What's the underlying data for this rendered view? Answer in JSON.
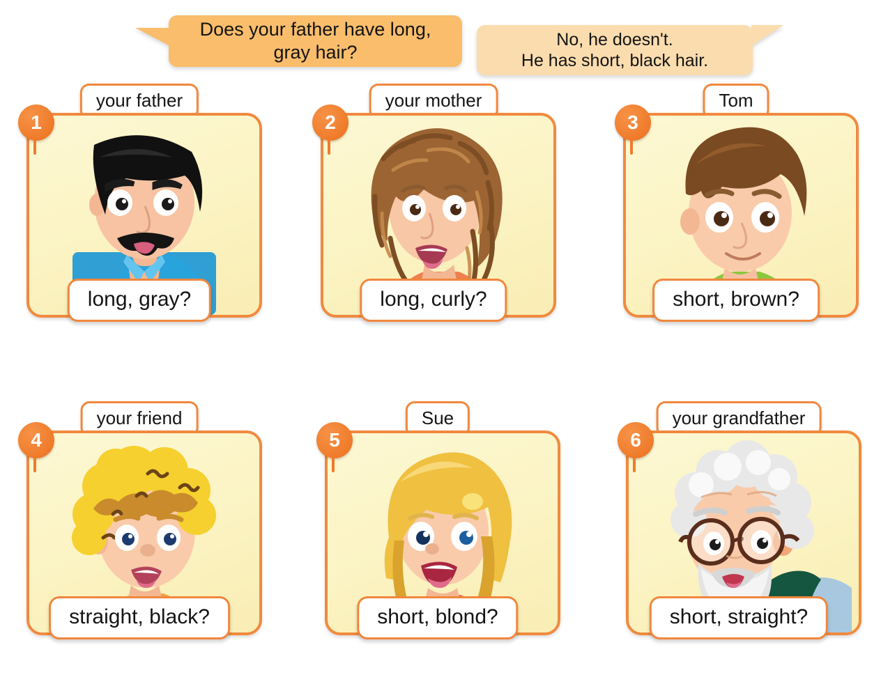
{
  "dialog": {
    "question": "Does your father have long,\ngray hair?",
    "answer": "No, he doesn't.\nHe has short, black hair.",
    "question_color": "#f9bd6c",
    "answer_color": "#fbdcae"
  },
  "theme": {
    "border_color": "#f08a3e",
    "badge_color": "#ef7b2a",
    "card_bg": "#fbf3c2",
    "box_bg": "#ffffff"
  },
  "cards": [
    {
      "number": "1",
      "name": "your father",
      "caption": "long, gray?",
      "art": "man-black-hair-mustache-blue-shirt"
    },
    {
      "number": "2",
      "name": "your mother",
      "caption": "long, curly?",
      "art": "woman-long-curly-brown-hair-orange-top"
    },
    {
      "number": "3",
      "name": "Tom",
      "caption": "short, brown?",
      "art": "boy-short-brown-hair-green-shirt"
    },
    {
      "number": "4",
      "name": "your friend",
      "caption": "straight, black?",
      "art": "boy-curly-blond-hair-orange-shirt"
    },
    {
      "number": "5",
      "name": "Sue",
      "caption": "short, blond?",
      "art": "girl-blond-bob-red-top"
    },
    {
      "number": "6",
      "name": "your grandfather",
      "caption": "short, straight?",
      "art": "old-man-white-hair-beard-glasses-green-sweater"
    }
  ]
}
